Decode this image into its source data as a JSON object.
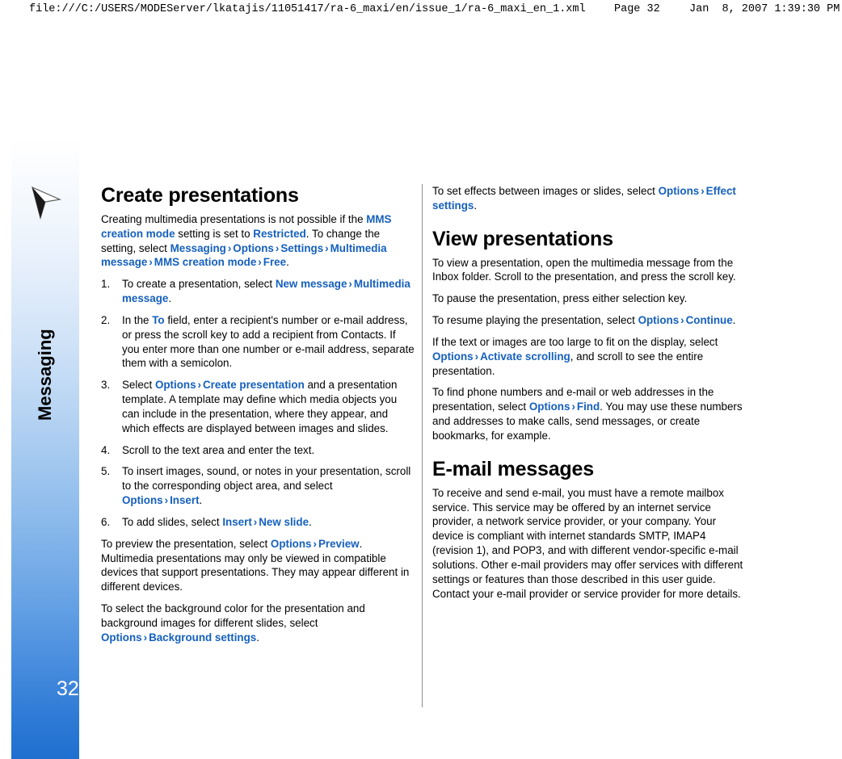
{
  "print_header": {
    "path": "file:///C:/USERS/MODEServer/lkatajis/11051417/ra-6_maxi/en/issue_1/ra-6_maxi_en_1.xml",
    "page": "Page 32",
    "date": "Jan  8, 2007 1:39:30 PM"
  },
  "spine": {
    "chapter_label": "Messaging",
    "page_number": "32",
    "icon_name": "messaging-arrow-icon"
  },
  "left_column": {
    "heading": "Create presentations",
    "intro": {
      "t1": "Creating multimedia presentations is not possible if the ",
      "k1": "MMS creation mode",
      "t2": " setting is set to ",
      "k2": "Restricted",
      "t3": ". To change the setting, select ",
      "k3": "Messaging",
      "k4": "Options",
      "k5": "Settings",
      "k6": "Multimedia message",
      "k7": "MMS creation mode",
      "k8": "Free",
      "t4": "."
    },
    "steps": [
      {
        "num": "1.",
        "t1": "To create a presentation, select ",
        "k1": "New message",
        "k2": "Multimedia message",
        "t2": "."
      },
      {
        "num": "2.",
        "t1": "In the ",
        "k1": "To",
        "t2": " field, enter a recipient's number or e-mail address, or press the scroll key to add a recipient from Contacts. If you enter more than one number or e-mail address, separate them with a semicolon."
      },
      {
        "num": "3.",
        "t1": "Select ",
        "k1": "Options",
        "k2": "Create presentation",
        "t2": " and a presentation template. A template may define which media objects you can include in the presentation, where they appear, and which effects are displayed between images and slides."
      },
      {
        "num": "4.",
        "t1": "Scroll to the text area and enter the text."
      },
      {
        "num": "5.",
        "t1": "To insert images, sound, or notes in your presentation, scroll to the corresponding object area, and select ",
        "k1": "Options",
        "k2": "Insert",
        "t2": "."
      },
      {
        "num": "6.",
        "t1": "To add slides, select ",
        "k1": "Insert",
        "k2": "New slide",
        "t2": "."
      }
    ],
    "para_preview": {
      "t1": "To preview the presentation, select ",
      "k1": "Options",
      "k2": "Preview",
      "t2": ". Multimedia presentations may only be viewed in compatible devices that support presentations. They may appear different in different devices."
    },
    "para_background": {
      "t1": "To select the background color for the presentation and background images for different slides, select ",
      "k1": "Options",
      "k2": "Background settings",
      "t2": "."
    }
  },
  "right_column": {
    "para_effects": {
      "t1": "To set effects between images or slides, select ",
      "k1": "Options",
      "k2": "Effect settings",
      "t2": "."
    },
    "heading_view": "View presentations",
    "para_view": "To view a presentation, open the multimedia message from the Inbox folder. Scroll to the presentation, and press the scroll key.",
    "para_pause": "To pause the presentation, press either selection key.",
    "para_resume": {
      "t1": "To resume playing the presentation, select ",
      "k1": "Options",
      "k2": "Continue",
      "t2": "."
    },
    "para_scroll": {
      "t1": "If the text or images are too large to fit on the display, select ",
      "k1": "Options",
      "k2": "Activate scrolling",
      "t2": ", and scroll to see the entire presentation."
    },
    "para_find": {
      "t1": "To find phone numbers and e-mail or web addresses in the presentation, select ",
      "k1": "Options",
      "k2": "Find",
      "t2": ". You may use these numbers and addresses to make calls, send messages, or create bookmarks, for example."
    },
    "heading_email": "E-mail messages",
    "para_email": "To receive and send e-mail, you must have a remote mailbox service. This service may be offered by an internet service provider, a network service provider, or your company. Your device is compliant with internet standards SMTP, IMAP4 (revision 1), and POP3, and with different vendor-specific e-mail solutions. Other e-mail providers may offer services with different settings or features than those described in this user guide. Contact your e-mail provider or service provider for more details."
  },
  "colors": {
    "keyword": "#1560bd",
    "spine_bottom": "#1f6fd0"
  }
}
